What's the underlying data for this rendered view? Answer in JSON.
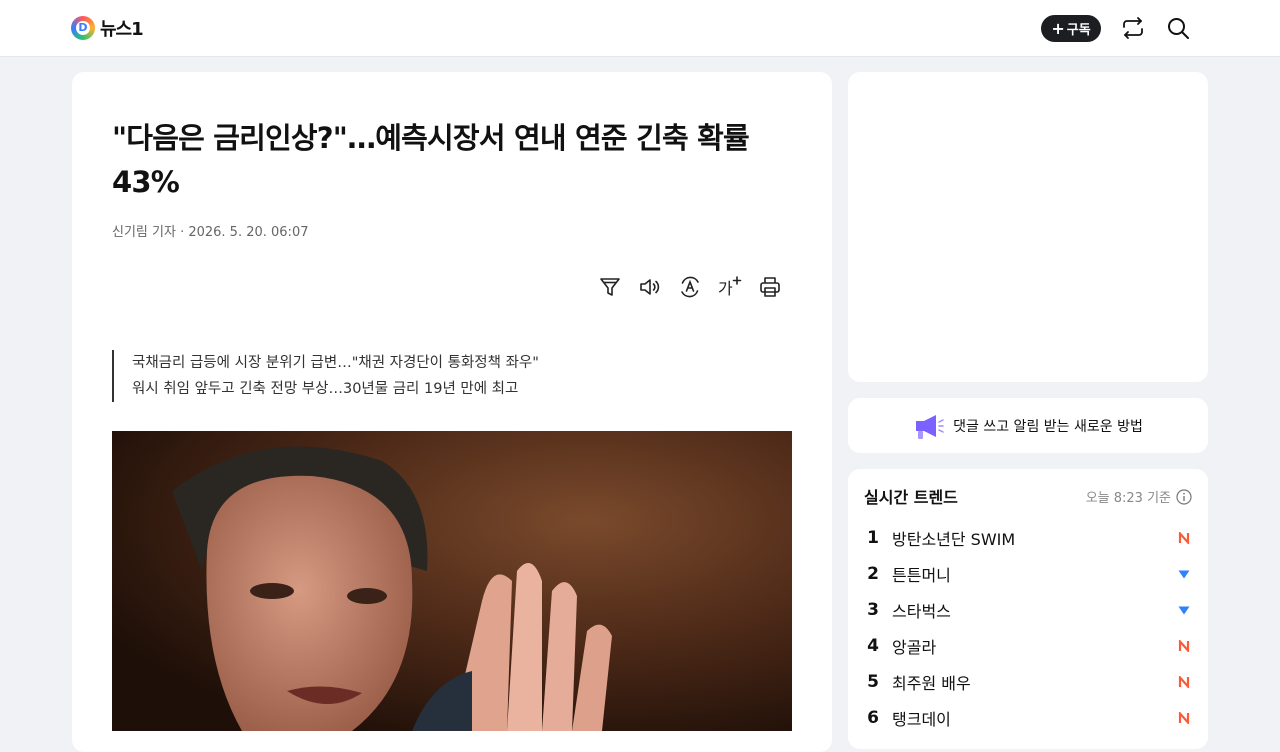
{
  "header": {
    "logo_mark": "D",
    "logo_text": "뉴스1",
    "subscribe_plus": "+",
    "subscribe_label": "구독",
    "icons": [
      "share-icon",
      "search-icon"
    ]
  },
  "article": {
    "headline": "\"다음은 금리인상?\"…예측시장서 연내 연준 긴축 확률 43%",
    "byline": "신기림 기자 · 2026. 5. 20. 06:07",
    "toolbar_icons": [
      "filter-icon",
      "speaker-icon",
      "translate-icon",
      "font-size-icon",
      "print-icon"
    ],
    "font_size_label": "가",
    "summary": [
      "국채금리 급등에 시장 분위기 급변…\"채권 자경단이 통화정책 좌우\"",
      "워시 취임 앞두고 긴축 전망 부상…30년물 금리 19년 만에 최고"
    ]
  },
  "sidebar": {
    "notice_text": "댓글 쓰고 알림 받는 새로운 방법",
    "trend": {
      "title": "실시간 트렌드",
      "updated": "오늘 8:23 기준",
      "items": [
        {
          "rank": "1",
          "label": "방탄소년단 SWIM",
          "status": "new"
        },
        {
          "rank": "2",
          "label": "튼튼머니",
          "status": "down"
        },
        {
          "rank": "3",
          "label": "스타벅스",
          "status": "down"
        },
        {
          "rank": "4",
          "label": "앙골라",
          "status": "new"
        },
        {
          "rank": "5",
          "label": "최주원 배우",
          "status": "new"
        },
        {
          "rank": "6",
          "label": "탱크데이",
          "status": "new"
        }
      ]
    }
  },
  "colors": {
    "background": "#f1f2f6",
    "card": "#ffffff",
    "new_badge": "#ff5a36",
    "down_badge": "#2f80ff",
    "notice_icon": "#7b61ff"
  }
}
